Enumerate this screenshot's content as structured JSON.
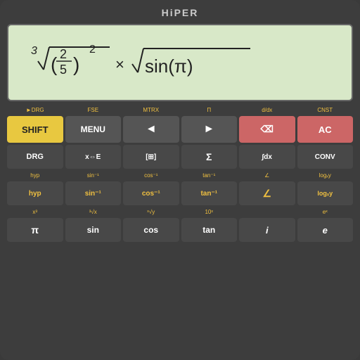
{
  "app": {
    "title": "HiPER"
  },
  "display": {
    "expression": "³√(2/5)² × √sin(π)"
  },
  "rows": [
    {
      "id": "row-top",
      "sublabels": [
        "►DRG",
        "FSE",
        "MTRX",
        "Π",
        "d/dx",
        "CNST"
      ],
      "buttons": [
        {
          "label": "SHIFT",
          "type": "shift"
        },
        {
          "label": "MENU",
          "type": "menu"
        },
        {
          "label": "◄",
          "type": "nav"
        },
        {
          "label": "►",
          "type": "nav"
        },
        {
          "label": "⌫",
          "type": "backspace"
        },
        {
          "label": "AC",
          "type": "ac"
        }
      ]
    },
    {
      "id": "row-2",
      "sublabels": [],
      "buttons": [
        {
          "label": "DRG",
          "type": "dark",
          "sub": ""
        },
        {
          "label": "x⇔E",
          "type": "dark",
          "sub": ""
        },
        {
          "label": "[⊞]",
          "type": "dark",
          "sub": ""
        },
        {
          "label": "Σ",
          "type": "dark",
          "sub": ""
        },
        {
          "label": "∫dx",
          "type": "dark",
          "sub": ""
        },
        {
          "label": "CONV",
          "type": "dark",
          "sub": ""
        }
      ]
    },
    {
      "id": "row-3",
      "sublabels": [
        "hyp",
        "sin⁻¹",
        "cos⁻¹",
        "tan⁻¹",
        "∠",
        "logₓy"
      ],
      "buttons": [
        {
          "label": "hyp",
          "type": "dark-yellow"
        },
        {
          "label": "sin⁻¹",
          "type": "dark-yellow"
        },
        {
          "label": "cos⁻¹",
          "type": "dark-yellow"
        },
        {
          "label": "tan⁻¹",
          "type": "dark-yellow"
        },
        {
          "label": "∠",
          "type": "dark-yellow"
        },
        {
          "label": "logₓy",
          "type": "dark-yellow"
        }
      ]
    },
    {
      "id": "row-4",
      "sublabels": [
        "x³",
        "³√x",
        "ˣ√y",
        "10ˣ",
        "",
        "eˣ"
      ],
      "buttons": [
        {
          "label": "π",
          "type": "dark"
        },
        {
          "label": "sin",
          "type": "dark"
        },
        {
          "label": "cos",
          "type": "dark"
        },
        {
          "label": "tan",
          "type": "dark"
        },
        {
          "label": "i",
          "type": "dark"
        },
        {
          "label": "e",
          "type": "dark"
        }
      ]
    }
  ]
}
